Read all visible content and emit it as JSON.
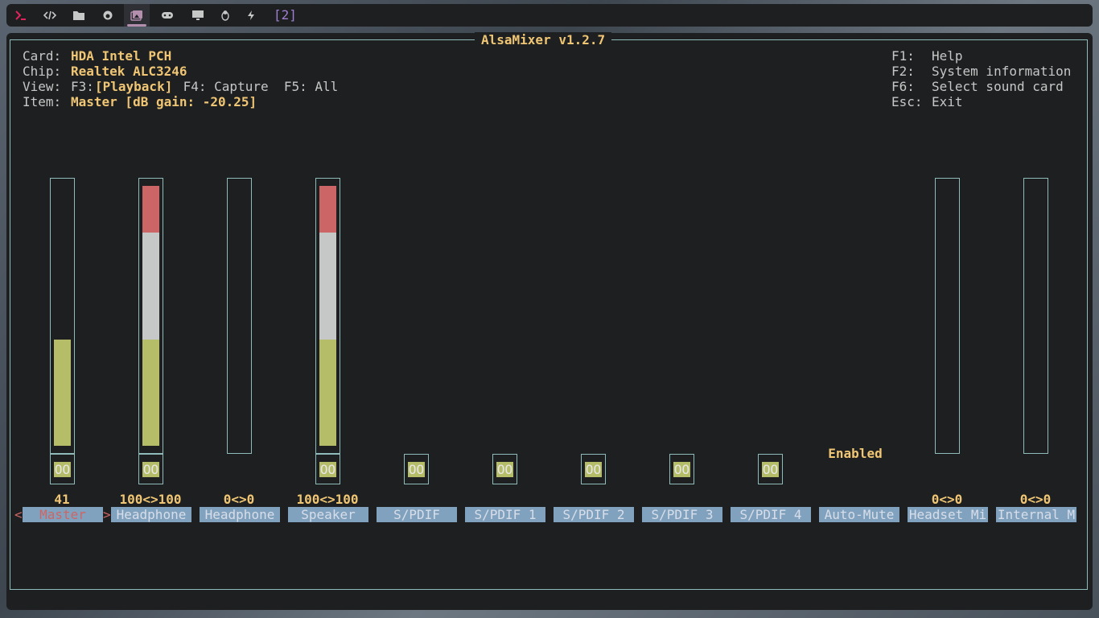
{
  "topbar": {
    "icons": [
      "terminal-icon",
      "code-icon",
      "folder-icon",
      "firefox-icon",
      "gallery-icon",
      "gamepad-icon",
      "monitor-icon",
      "linux-icon",
      "bolt-icon"
    ],
    "count": "[2]"
  },
  "app": {
    "title": "AlsaMixer v1.2.7"
  },
  "info": {
    "card_label": "Card:",
    "card_value": "HDA Intel PCH",
    "chip_label": "Chip:",
    "chip_value": "Realtek ALC3246",
    "view_label": "View:",
    "view_f3": "F3:",
    "view_playback": "[Playback]",
    "view_rest": " F4: Capture  F5: All",
    "item_label": "Item:",
    "item_value": "Master [dB gain: -20.25]"
  },
  "help": [
    {
      "key": "F1:",
      "text": "Help"
    },
    {
      "key": "F2:",
      "text": "System information"
    },
    {
      "key": "F6:",
      "text": "Select sound card"
    },
    {
      "key": "Esc:",
      "text": "Exit"
    }
  ],
  "controls": [
    {
      "label": "Master",
      "value": "41",
      "level": 0.41
    },
    {
      "label": "Headphone",
      "value": "100<>100",
      "level": 1.0
    },
    {
      "label": "Headphone",
      "value": "0<>0",
      "level": 0.0
    },
    {
      "label": "Speaker",
      "value": "100<>100",
      "level": 1.0
    },
    {
      "label": "S/PDIF",
      "switch": "OO"
    },
    {
      "label": "S/PDIF 1",
      "switch": "OO"
    },
    {
      "label": "S/PDIF 2",
      "switch": "OO"
    },
    {
      "label": "S/PDIF 3",
      "switch": "OO"
    },
    {
      "label": "S/PDIF 4",
      "switch": "OO"
    },
    {
      "label": "Auto-Mute",
      "state": "Enabled"
    },
    {
      "label": "Headset Mi",
      "value": "0<>0",
      "level": 0.0
    },
    {
      "label": "Internal M",
      "value": "0<>0",
      "level": 0.0
    }
  ],
  "switch_text": "OO",
  "selection": {
    "left": "<",
    "right": ">"
  },
  "colors": {
    "low": "#b5bd68",
    "mid": "#c5c8c6",
    "high": "#cc6666",
    "accent": "#f0c674",
    "label_bg": "#81a2be"
  }
}
